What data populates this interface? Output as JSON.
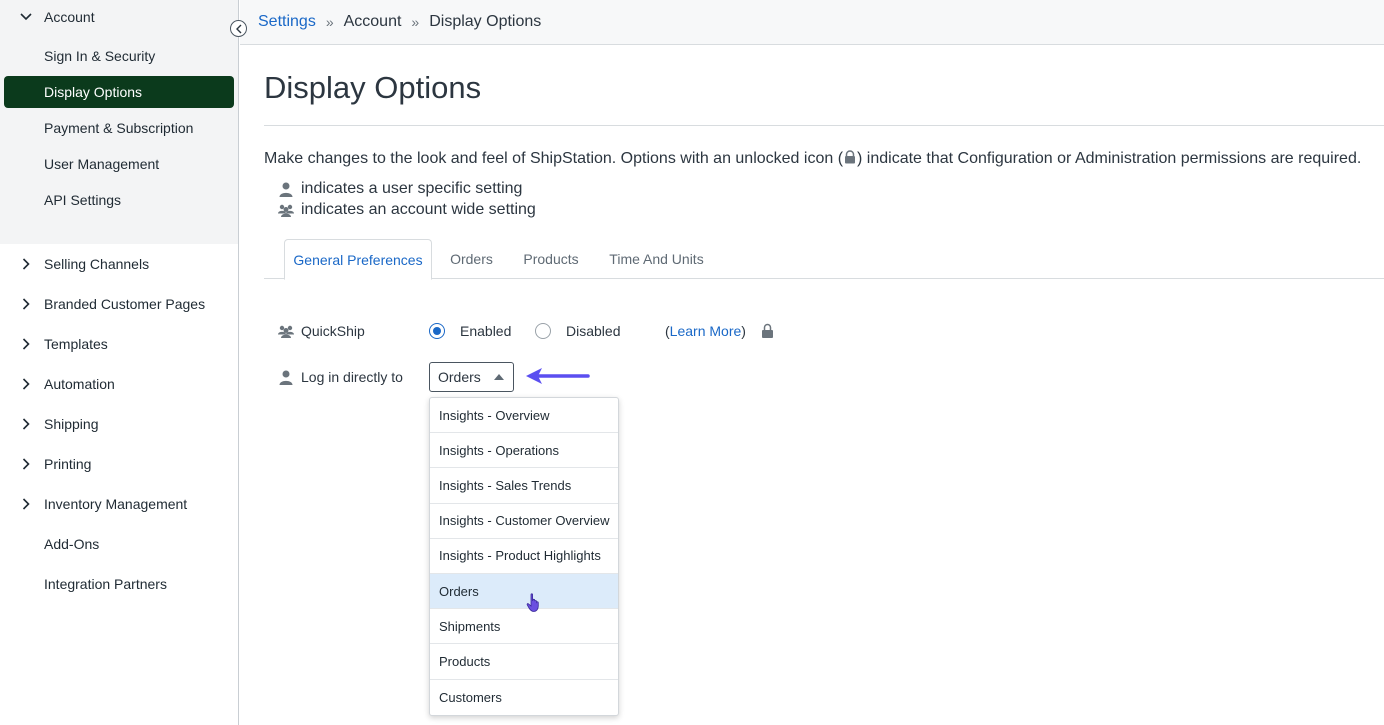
{
  "sidebar": {
    "account_label": "Account",
    "account_items": [
      {
        "label": "Sign In & Security"
      },
      {
        "label": "Display Options"
      },
      {
        "label": "Payment & Subscription"
      },
      {
        "label": "User Management"
      },
      {
        "label": "API Settings"
      }
    ],
    "sections": [
      {
        "label": "Selling Channels"
      },
      {
        "label": "Branded Customer Pages"
      },
      {
        "label": "Templates"
      },
      {
        "label": "Automation"
      },
      {
        "label": "Shipping"
      },
      {
        "label": "Printing"
      },
      {
        "label": "Inventory Management"
      },
      {
        "label": "Add-Ons"
      },
      {
        "label": "Integration Partners"
      }
    ]
  },
  "breadcrumb": {
    "root": "Settings",
    "sep": "»",
    "middle": "Account",
    "current": "Display Options"
  },
  "page": {
    "title": "Display Options",
    "intro_before": "Make changes to the look and feel of ShipStation. Options with an unlocked icon (",
    "intro_after": ") indicate that Configuration or Administration permissions are required.",
    "legend_user": "indicates a user specific setting",
    "legend_account": "indicates an account wide setting"
  },
  "tabs": [
    {
      "label": "General Preferences"
    },
    {
      "label": "Orders"
    },
    {
      "label": "Products"
    },
    {
      "label": "Time And Units"
    }
  ],
  "settings": {
    "quickship": {
      "label": "QuickShip",
      "enabled_label": "Enabled",
      "disabled_label": "Disabled",
      "selected": "Enabled",
      "learn_open": "(",
      "learn_more": "Learn More",
      "learn_close": ")"
    },
    "login": {
      "label": "Log in directly to",
      "value": "Orders",
      "options": [
        "Insights - Overview",
        "Insights - Operations",
        "Insights - Sales Trends",
        "Insights - Customer Overview",
        "Insights - Product Highlights",
        "Orders",
        "Shipments",
        "Products",
        "Customers"
      ],
      "highlighted": "Orders"
    }
  },
  "colors": {
    "accent": "#1a68c7",
    "active_nav": "#0b3a1c",
    "arrow": "#5b4ff0"
  }
}
